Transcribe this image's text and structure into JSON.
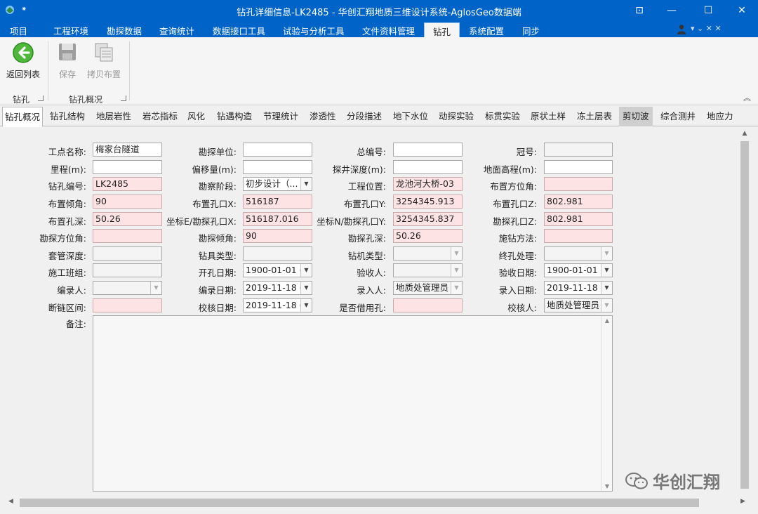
{
  "titlebar": {
    "title": "钻孔详细信息-LK2485 - 华创汇翔地质三维设计系统-AglosGeo数据端",
    "qa_symbol": "⁕",
    "restore_symbol": "⊡",
    "minimize_symbol": "—",
    "maximize_symbol": "☐",
    "close_symbol": "✕"
  },
  "menu": {
    "items": [
      "项目",
      "工程环境",
      "勘探数据",
      "查询统计",
      "数据接口工具",
      "试验与分析工具",
      "文件资料管理",
      "钻孔",
      "系统配置",
      "同步"
    ],
    "active": "钻孔",
    "right_icons": "▾ ⌄ ✕ ✕"
  },
  "ribbon": {
    "buttons": {
      "back": "返回列表",
      "save": "保存",
      "copy": "拷贝布置"
    },
    "groups": {
      "group1": "钻孔",
      "group2": "钻孔概况"
    },
    "collapse_symbol": "︽"
  },
  "tabs": [
    "钻孔概况",
    "钻孔结构",
    "地层岩性",
    "岩芯指标",
    "风化",
    "钻遇构造",
    "节理统计",
    "渗透性",
    "分段描述",
    "地下水位",
    "动探实验",
    "标贯实验",
    "原状土样",
    "冻土层表",
    "剪切波",
    "综合测井",
    "地应力"
  ],
  "form": {
    "labels": {
      "r1c1": "工点名称:",
      "r1c2": "勘探单位:",
      "r1c3": "总编号:",
      "r1c4": "冠号:",
      "r2c1": "里程(m):",
      "r2c2": "偏移量(m):",
      "r2c3": "探井深度(m):",
      "r2c4": "地面高程(m):",
      "r3c1": "钻孔编号:",
      "r3c2": "勘察阶段:",
      "r3c3": "工程位置:",
      "r3c4": "布置方位角:",
      "r4c1": "布置倾角:",
      "r4c2": "布置孔口X:",
      "r4c3": "布置孔口Y:",
      "r4c4": "布置孔口Z:",
      "r5c1": "布置孔深:",
      "r5c2": "坐标E/勘探孔口X:",
      "r5c3": "坐标N/勘探孔口Y:",
      "r5c4": "勘探孔口Z:",
      "r6c1": "勘探方位角:",
      "r6c2": "勘探倾角:",
      "r6c3": "勘探孔深:",
      "r6c4": "施钻方法:",
      "r7c1": "套管深度:",
      "r7c2": "钻具类型:",
      "r7c3": "钻机类型:",
      "r7c4": "终孔处理:",
      "r8c1": "施工班组:",
      "r8c2": "开孔日期:",
      "r8c3": "验收人:",
      "r8c4": "验收日期:",
      "r9c1": "编录人:",
      "r9c2": "编录日期:",
      "r9c3": "录入人:",
      "r9c4": "录入日期:",
      "r10c1": "断链区间:",
      "r10c2": "校核日期:",
      "r10c3": "是否借用孔:",
      "r10c4": "校核人:",
      "remark": "备注:"
    },
    "values": {
      "r1c1": "梅家台隧道",
      "r1c2": "",
      "r1c3": "",
      "r1c4": "",
      "r2c1": "",
      "r2c2": "",
      "r2c3": "",
      "r2c4": "",
      "r3c1": "LK2485",
      "r3c2": "初步设计（...",
      "r3c3": "龙池河大桥-03",
      "r3c4": "",
      "r4c1": "90",
      "r4c2": "516187",
      "r4c3": "3254345.913",
      "r4c4": "802.981",
      "r5c1": "50.26",
      "r5c2": "516187.016",
      "r5c3": "3254345.837",
      "r5c4": "802.981",
      "r6c1": "",
      "r6c2": "90",
      "r6c3": "50.26",
      "r6c4": "",
      "r7c1": "",
      "r7c2": "",
      "r7c3": "",
      "r7c4": "",
      "r8c1": "",
      "r8c2": "1900-01-01 (",
      "r8c3": "",
      "r8c4": "1900-01-01 (",
      "r9c1": "",
      "r9c2": "2019-11-18 (",
      "r9c3": "地质处管理员",
      "r9c4": "2019-11-18 (",
      "r10c1": "",
      "r10c2": "2019-11-18 (",
      "r10c3": "",
      "r10c4": "地质处管理员",
      "remark": ""
    }
  },
  "watermark": {
    "text": "华创汇翔"
  }
}
